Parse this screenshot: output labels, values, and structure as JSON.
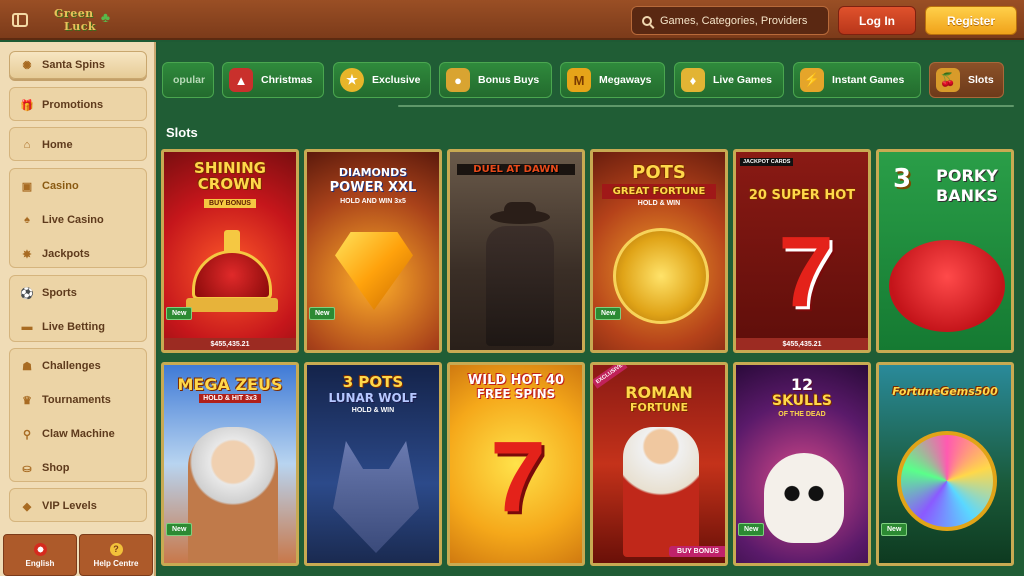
{
  "header": {
    "logo_line1": "Green",
    "logo_line2": "Luck",
    "search_placeholder": "Games, Categories, Providers",
    "login_label": "Log In",
    "register_label": "Register"
  },
  "sidebar": {
    "santa": "Santa Spins",
    "items": {
      "promotions": "Promotions",
      "home": "Home",
      "casino": "Casino",
      "live_casino": "Live Casino",
      "jackpots": "Jackpots",
      "sports": "Sports",
      "live_betting": "Live Betting",
      "challenges": "Challenges",
      "tournaments": "Tournaments",
      "claw_machine": "Claw Machine",
      "shop": "Shop",
      "vip_levels": "VIP Levels"
    },
    "language_label": "English",
    "help_label": "Help Centre"
  },
  "categories": {
    "popular": "opular",
    "christmas": "Christmas",
    "exclusive": "Exclusive",
    "bonus_buys": "Bonus Buys",
    "megaways": "Megaways",
    "live_games": "Live Games",
    "instant_games": "Instant Games",
    "slots": "Slots"
  },
  "section_title": "Slots",
  "games": {
    "shining_crown": {
      "l1": "SHINING",
      "l2": "CROWN",
      "sub": "BUY BONUS",
      "badge": "New",
      "jackpot": "$455,435.21"
    },
    "diamonds_power": {
      "l1": "DIAMONDS",
      "l2": "POWER XXL",
      "sub": "HOLD AND WIN 3x5",
      "badge": "New"
    },
    "duel_at_dawn": {
      "l1": "DUEL AT DAWN"
    },
    "pots_fortune": {
      "l1": "POTS",
      "l2": "GREAT FORTUNE",
      "sub": "HOLD & WIN",
      "badge": "New"
    },
    "super_hot": {
      "top": "JACKPOT CARDS",
      "l1": "20 SUPER HOT",
      "jackpot": "$455,435.21"
    },
    "porky_banks": {
      "l1": "3",
      "l2": "PORKY",
      "l3": "BANKS"
    },
    "mega_zeus": {
      "l1": "MEGA ZEUS",
      "sub": "HOLD & HIT 3x3",
      "badge": "New"
    },
    "lunar_wolf": {
      "l1": "3 POTS",
      "l2": "LUNAR WOLF",
      "sub": "HOLD & WIN"
    },
    "wild_hot": {
      "l1": "WILD HOT 40",
      "l2": "FREE SPINS"
    },
    "roman_fortune": {
      "excl": "EXCLUSIVE",
      "l1": "ROMAN",
      "l2": "FORTUNE",
      "sub": "BUY BONUS"
    },
    "skulls": {
      "l1": "12",
      "l2": "SKULLS",
      "sub": "OF THE DEAD",
      "badge": "New"
    },
    "fortune_gems": {
      "l1": "FortuneGems500",
      "badge": "New"
    }
  }
}
